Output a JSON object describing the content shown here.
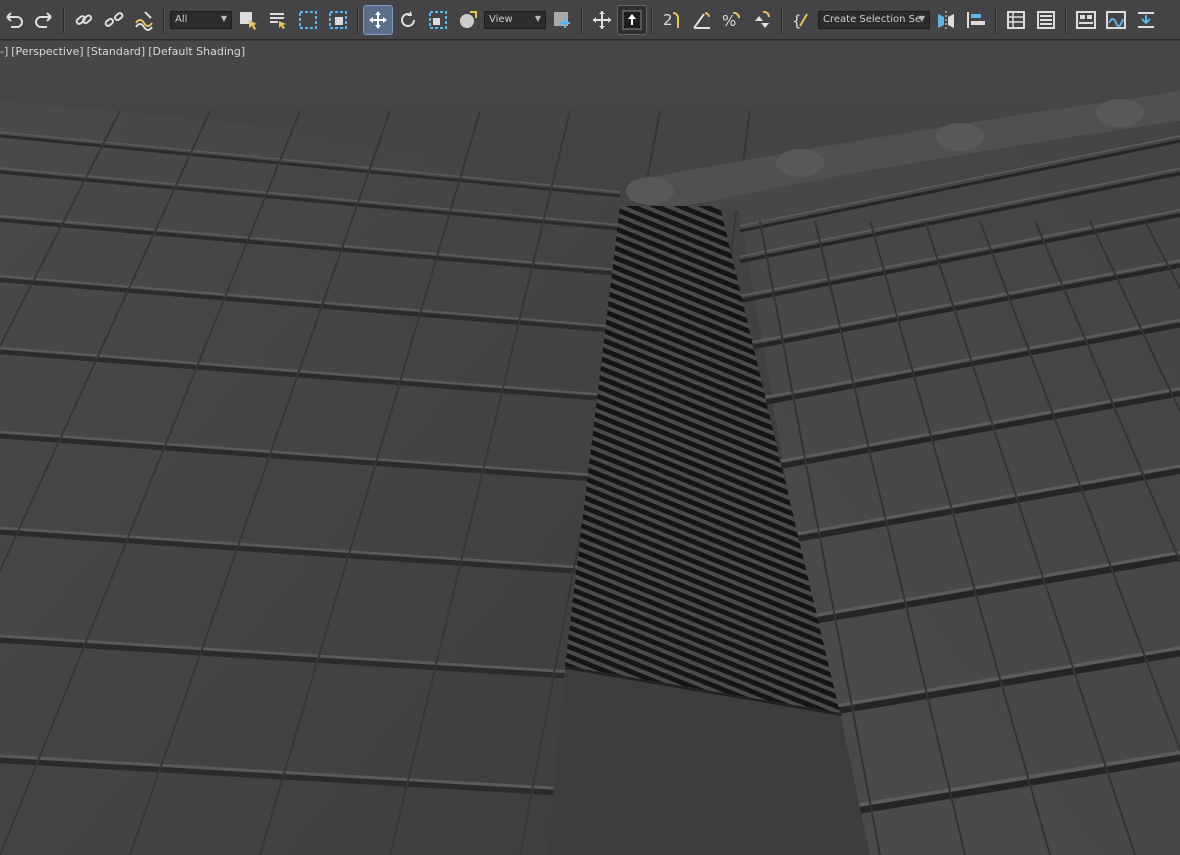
{
  "toolbar": {
    "selection_filter": "All",
    "coord_system": "View",
    "named_selection": "Create Selection Se",
    "buttons": [
      {
        "name": "undo-button",
        "icon": "undo-icon"
      },
      {
        "name": "redo-button",
        "icon": "redo-icon"
      },
      {
        "name": "link-button",
        "icon": "link-icon"
      },
      {
        "name": "unlink-button",
        "icon": "unlink-icon"
      },
      {
        "name": "bind-spacewarp-button",
        "icon": "spacewarp-icon"
      }
    ],
    "colors": {
      "accent": "#3f7fd0",
      "active_bg": "#5b6f8a",
      "snap_yellow": "#e8c35a"
    }
  },
  "viewport": {
    "labels": [
      "[+]",
      "[Perspective]",
      "[Standard]",
      "[Default Shading]"
    ],
    "label_display": [
      "-]",
      "[Perspective]",
      "[Standard]",
      "[Default Shading]"
    ]
  }
}
